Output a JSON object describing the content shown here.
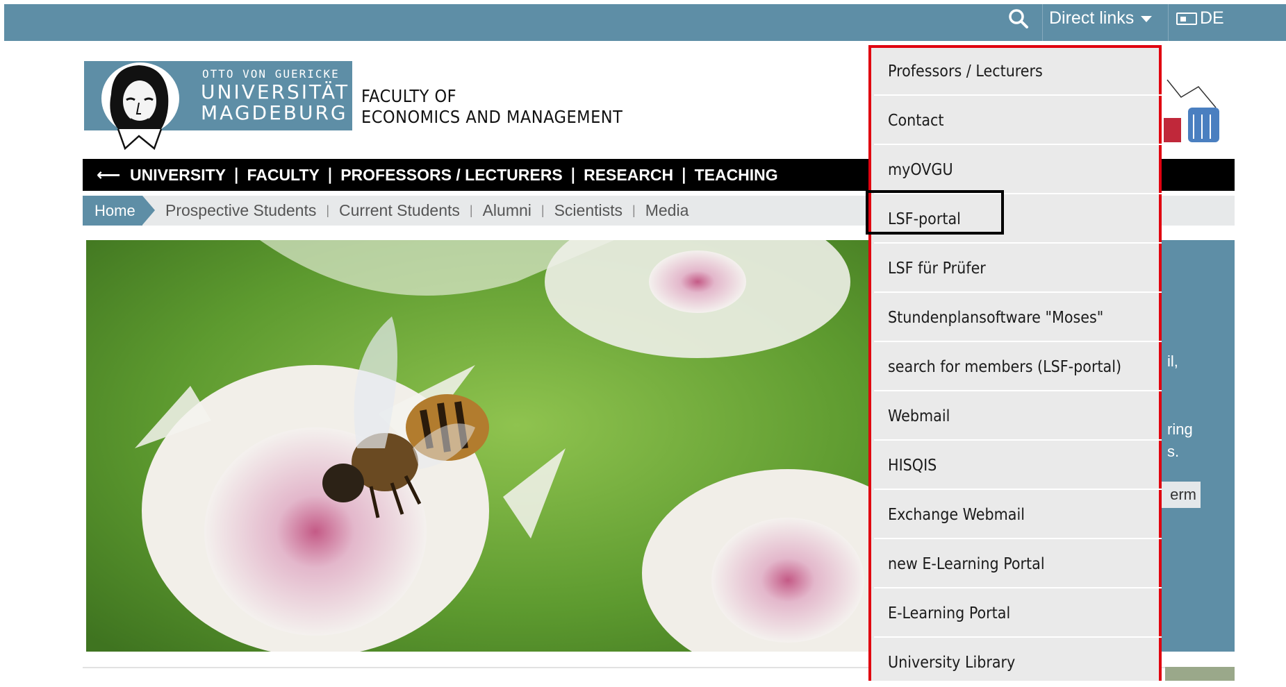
{
  "topbar": {
    "search_icon": "search-icon",
    "direct_links_label": "Direct links",
    "language_label": "DE",
    "language_icon": "language-card-icon"
  },
  "logo": {
    "line1": "OTTO VON GUERICKE",
    "line2": "UNIVERSITÄT",
    "line3": "MAGDEBURG"
  },
  "faculty": {
    "line1": "FACULTY OF",
    "line2": "ECONOMICS AND MANAGEMENT"
  },
  "main_nav": {
    "back_icon": "arrow-left-icon",
    "items": [
      "UNIVERSITY",
      "FACULTY",
      "PROFESSORS / LECTURERS",
      "RESEARCH",
      "TEACHING"
    ]
  },
  "breadcrumb": {
    "home": "Home",
    "links": [
      "Prospective Students",
      "Current Students",
      "Alumni",
      "Scientists",
      "Media"
    ]
  },
  "side_panel": {
    "fragments": [
      "il,",
      "ring",
      "s.",
      "erm"
    ]
  },
  "direct_links_menu": {
    "items": [
      "Professors / Lecturers",
      "Contact",
      "myOVGU",
      "LSF-portal",
      "LSF für Prüfer",
      "Stundenplansoftware \"Moses\"",
      "search for members (LSF-portal)",
      "Webmail",
      "HISQIS",
      "Exchange Webmail",
      "new E-Learning Portal",
      "E-Learning Portal",
      "University Library"
    ],
    "highlighted_item": "LSF-portal"
  },
  "colors": {
    "brand": "#5e8ea6",
    "annotation_red": "#e0000f",
    "annotation_black": "#000000"
  }
}
